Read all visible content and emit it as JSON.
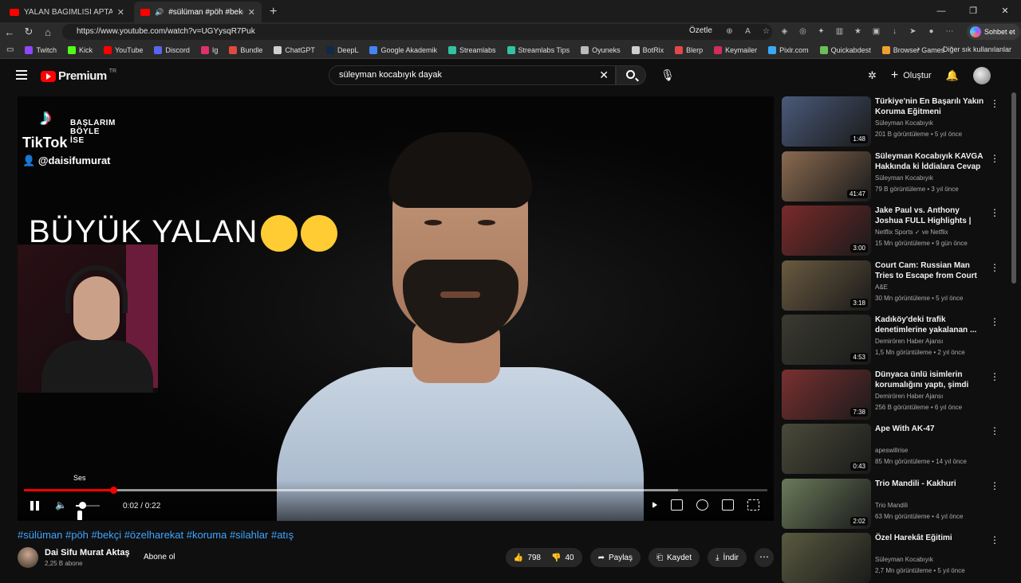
{
  "browser": {
    "tabs": [
      {
        "title": "YALAN BAĞIMLISI APTAL SÜLÜMAN"
      },
      {
        "title": "#sülüman #pöh #bekçi #özelh"
      }
    ],
    "url": "https://www.youtube.com/watch?v=UGYysqR7Puk",
    "ozetle_label": "Özetle",
    "sohbet_label": "Sohbet et",
    "bookmarks": [
      {
        "label": "Twitch",
        "color": "#9146ff"
      },
      {
        "label": "Kick",
        "color": "#53fc18"
      },
      {
        "label": "YouTube",
        "color": "#ff0000"
      },
      {
        "label": "Discord",
        "color": "#5865f2"
      },
      {
        "label": "Ig",
        "color": "#e1306c"
      },
      {
        "label": "Bundle",
        "color": "#e04a3f"
      },
      {
        "label": "ChatGPT",
        "color": "#cfcfcf"
      },
      {
        "label": "DeepL",
        "color": "#0f2b46"
      },
      {
        "label": "Google Akademik",
        "color": "#4285f4"
      },
      {
        "label": "Streamlabs",
        "color": "#31c3a2"
      },
      {
        "label": "Streamlabs Tips",
        "color": "#31c3a2"
      },
      {
        "label": "Oyuneks",
        "color": "#bbbbbb"
      },
      {
        "label": "BotRix",
        "color": "#cfcfcf"
      },
      {
        "label": "Blerp",
        "color": "#e34848"
      },
      {
        "label": "Keymailer",
        "color": "#d02e56"
      },
      {
        "label": "Pixlr.com",
        "color": "#3ba7f5"
      },
      {
        "label": "Quickabdest",
        "color": "#6bbf59"
      },
      {
        "label": "Browser Games",
        "color": "#f0a030"
      }
    ],
    "other_bookmarks": "Diğer sık kullanılanlar"
  },
  "youtube": {
    "logo_text": "Premium",
    "logo_region": "TR",
    "search_value": "süleyman kocabıyık dayak",
    "create_label": "Oluştur"
  },
  "player": {
    "tiktok_label": "TikTok",
    "tiktok_user": "@daisifumurat",
    "baslarim_text": "BAŞLARIM BÖYLE İSE",
    "overlay_text": "BÜYÜK YALAN",
    "volume_tooltip": "Ses",
    "time_display": "0:02 / 0:22",
    "progress_fraction": 0.12,
    "loaded_fraction": 0.88,
    "volume_fraction": 0.25
  },
  "video": {
    "hashtags": "#sülüman #pöh #bekçi #özelharekat #koruma #silahlar #atış",
    "channel_name": "Dai Sifu Murat Aktaş",
    "subscribers": "2,25 B abone",
    "subscribe_label": "Abone ol",
    "likes": "798",
    "dislikes": "40",
    "share_label": "Paylaş",
    "save_label": "Kaydet",
    "download_label": "İndir"
  },
  "recommendations": [
    {
      "title": "Türkiye'nin En Başarılı Yakın Koruma Eğitmeni",
      "channel": "Süleyman Kocabıyık",
      "meta": "201 B görüntüleme • 5 yıl önce",
      "duration": "1:48",
      "color": "#4a5a7a"
    },
    {
      "title": "Süleyman Kocabıyık KAVGA Hakkında ki İddialara Cevap ...",
      "channel": "Süleyman Kocabıyık",
      "meta": "79 B görüntüleme • 3 yıl önce",
      "duration": "41:47",
      "color": "#8a6a50"
    },
    {
      "title": "Jake Paul vs. Anthony Joshua FULL Highlights | Netflix",
      "channel": "Netflix Sports ✓ ve Netflix",
      "meta": "15 Mn görüntüleme • 9 gün önce",
      "duration": "3:00",
      "color": "#7a2a2a"
    },
    {
      "title": "Court Cam: Russian Man Tries to Escape from Court (Season ...",
      "channel": "A&E",
      "meta": "30 Mn görüntüleme • 5 yıl önce",
      "duration": "3:18",
      "color": "#6a5a40"
    },
    {
      "title": "Kadıköy'deki trafik denetimlerine yakalanan ...",
      "channel": "Demirören Haber Ajansı",
      "meta": "1,5 Mn görüntüleme • 2 yıl önce",
      "duration": "4:53",
      "color": "#3a3a30"
    },
    {
      "title": "Dünyaca ünlü isimlerin korumalığını yaptı, şimdi siyas...",
      "channel": "Demirören Haber Ajansı",
      "meta": "256 B görüntüleme • 6 yıl önce",
      "duration": "7:38",
      "color": "#7a3030"
    },
    {
      "title": "Ape With AK-47",
      "channel": "apeswillrise",
      "meta": "85 Mn görüntüleme • 14 yıl önce",
      "duration": "0:43",
      "color": "#4a4a3a"
    },
    {
      "title": "Trio Mandili - Kakhuri",
      "channel": "Trio Mandili",
      "meta": "63 Mn görüntüleme • 4 yıl önce",
      "duration": "2:02",
      "color": "#6a7a5a"
    },
    {
      "title": "Özel Harekât Eğitimi",
      "channel": "Süleyman Kocabıyık",
      "meta": "2,7 Mn görüntüleme • 5 yıl önce",
      "duration": "",
      "color": "#5a5a40"
    }
  ]
}
